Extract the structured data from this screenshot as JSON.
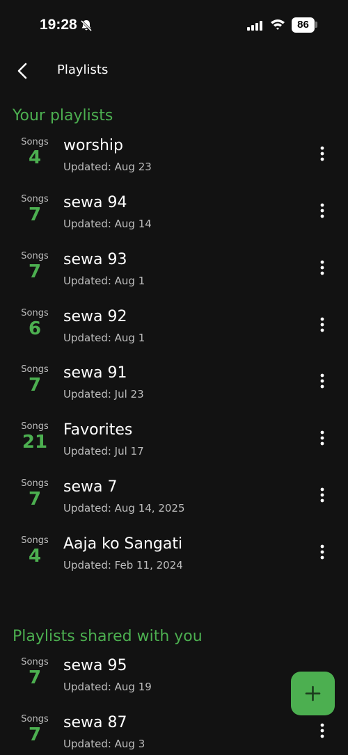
{
  "status_bar": {
    "time": "19:28",
    "battery": "86",
    "icons": [
      "bell-off-icon",
      "signal-icon",
      "wifi-icon",
      "battery-icon"
    ]
  },
  "header": {
    "title": "Playlists",
    "back_icon": "chevron-left-icon"
  },
  "your_playlists": {
    "heading": "Your playlists",
    "items": [
      {
        "songs_label": "Songs",
        "count": "4",
        "name": "worship",
        "updated": "Updated: Aug 23"
      },
      {
        "songs_label": "Songs",
        "count": "7",
        "name": "sewa 94",
        "updated": "Updated: Aug 14"
      },
      {
        "songs_label": "Songs",
        "count": "7",
        "name": "sewa 93",
        "updated": "Updated: Aug 1"
      },
      {
        "songs_label": "Songs",
        "count": "6",
        "name": "sewa 92",
        "updated": "Updated: Aug 1"
      },
      {
        "songs_label": "Songs",
        "count": "7",
        "name": "sewa 91",
        "updated": "Updated: Jul 23"
      },
      {
        "songs_label": "Songs",
        "count": "21",
        "name": "Favorites",
        "updated": "Updated: Jul 17"
      },
      {
        "songs_label": "Songs",
        "count": "7",
        "name": "sewa 7",
        "updated": "Updated: Aug 14, 2025"
      },
      {
        "songs_label": "Songs",
        "count": "4",
        "name": "Aaja ko Sangati",
        "updated": "Updated: Feb 11, 2024"
      }
    ]
  },
  "shared_playlists": {
    "heading": "Playlists shared with you",
    "items": [
      {
        "songs_label": "Songs",
        "count": "7",
        "name": "sewa 95",
        "updated": "Updated: Aug 19"
      },
      {
        "songs_label": "Songs",
        "count": "7",
        "name": "sewa 87",
        "updated": "Updated: Aug 3"
      }
    ]
  },
  "fab": {
    "icon": "plus-icon"
  },
  "colors": {
    "background": "#121212",
    "accent": "#4caf50",
    "secondary_text": "#bdbdbd"
  }
}
